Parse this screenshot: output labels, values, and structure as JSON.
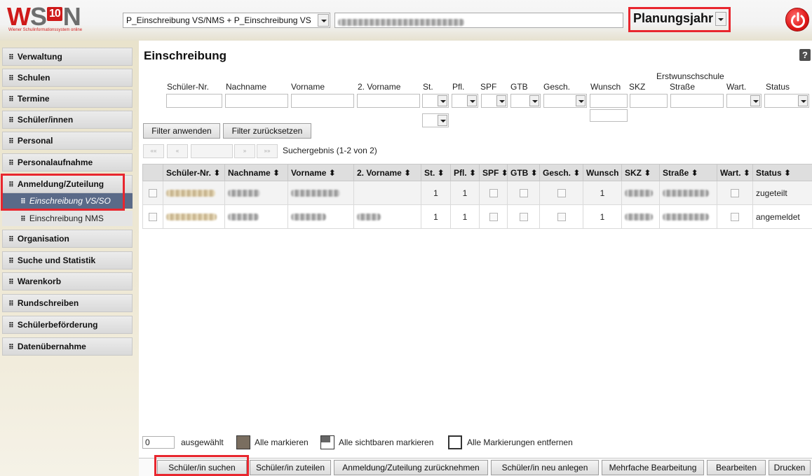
{
  "app": {
    "logo_text": "WSON",
    "logo_badge": "10",
    "logo_sub": "Wiener Schulinformationssystem online"
  },
  "header": {
    "school_select_value": "P_Einschreibung VS/NMS + P_Einschreibung VS",
    "planungsjahr_label": "Planungsjahr"
  },
  "sidebar": {
    "items": [
      {
        "label": "Verwaltung"
      },
      {
        "label": "Schulen"
      },
      {
        "label": "Termine"
      },
      {
        "label": "Schüler/innen"
      },
      {
        "label": "Personal"
      },
      {
        "label": "Personalaufnahme"
      },
      {
        "label": "Anmeldung/Zuteilung"
      },
      {
        "label": "Organisation"
      },
      {
        "label": "Suche und Statistik"
      },
      {
        "label": "Warenkorb"
      },
      {
        "label": "Rundschreiben"
      },
      {
        "label": "Schülerbeförderung"
      },
      {
        "label": "Datenübernahme"
      }
    ],
    "sub_items": [
      {
        "label": "Einschreibung VS/SO"
      },
      {
        "label": "Einschreibung NMS"
      }
    ]
  },
  "main": {
    "title": "Einschreibung",
    "help": "?",
    "filter_group_label": "Erstwunschschule",
    "filter_labels": {
      "schueler_nr": "Schüler-Nr.",
      "nachname": "Nachname",
      "vorname": "Vorname",
      "vorname2": "2. Vorname",
      "st": "St.",
      "pfl": "Pfl.",
      "spf": "SPF",
      "gtb": "GTB",
      "gesch": "Gesch.",
      "wunsch": "Wunsch",
      "skz": "SKZ",
      "strasse": "Straße",
      "wart": "Wart.",
      "status": "Status"
    },
    "filter_apply": "Filter anwenden",
    "filter_reset": "Filter zurücksetzen",
    "pager": {
      "first": "«« ",
      "prev": "«",
      "next": "»",
      "last": "»»"
    },
    "result_count": "Suchergebnis (1-2 von 2)",
    "table": {
      "columns": [
        "Schüler-Nr. ⬍",
        "Nachname ⬍",
        "Vorname ⬍",
        "2. Vorname ⬍",
        "St. ⬍",
        "Pfl. ⬍",
        "SPF ⬍",
        "GTB ⬍",
        "Gesch. ⬍",
        "Wunsch",
        "SKZ ⬍",
        "Straße ⬍",
        "Wart. ⬍",
        "Status ⬍"
      ],
      "rows": [
        {
          "st": "1",
          "pfl": "1",
          "wunsch": "1",
          "status": "zugeteilt"
        },
        {
          "st": "1",
          "pfl": "1",
          "wunsch": "1",
          "status": "angemeldet"
        }
      ]
    },
    "selection": {
      "count": "0",
      "label": "ausgewählt",
      "mark_all": "Alle markieren",
      "mark_visible": "Alle sichtbaren markieren",
      "mark_none": "Alle Markierungen entfernen"
    },
    "actions": [
      "Schüler/in suchen",
      "Schüler/in zuteilen",
      "Anmeldung/Zuteilung zurücknehmen",
      "Schüler/in neu anlegen",
      "Mehrfache Bearbeitung",
      "Bearbeiten",
      "Drucken"
    ]
  },
  "colors": {
    "highlight": "#e8262e",
    "active_nav": "#5a6a88",
    "sidebar_bg": "#e9e3cc",
    "logo_red": "#cf1a1a"
  }
}
